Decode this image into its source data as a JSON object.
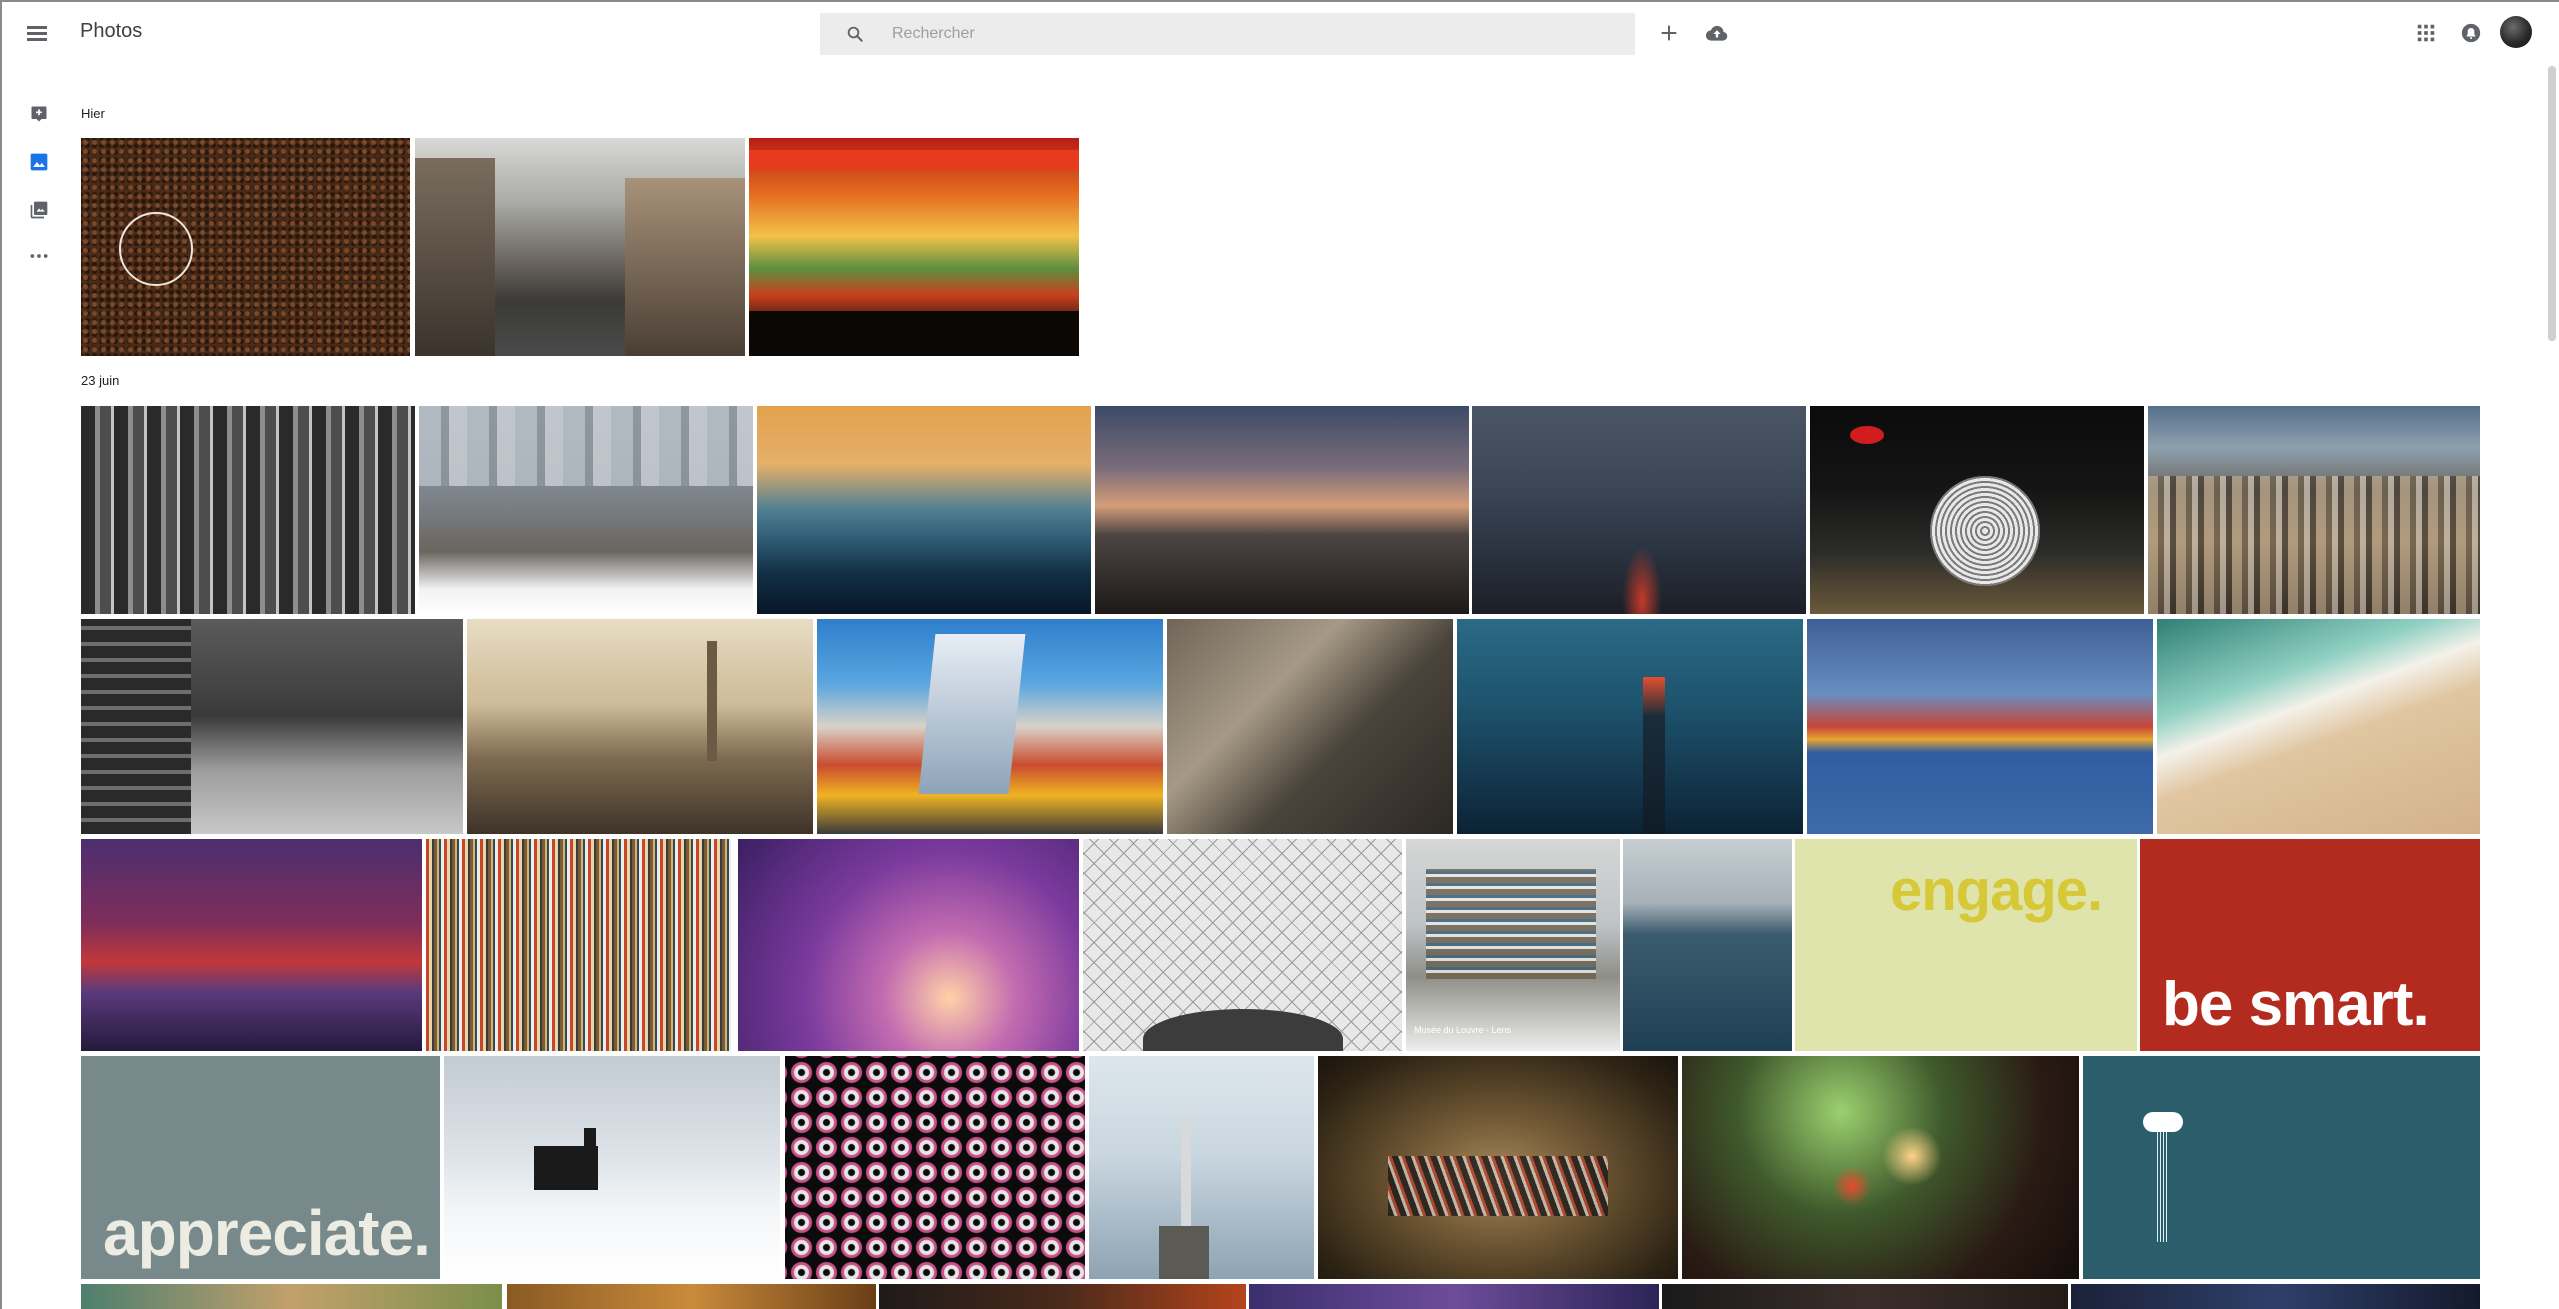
{
  "header": {
    "app_title": "Photos",
    "search_placeholder": "Rechercher"
  },
  "icons": {
    "menu": "menu-icon",
    "search": "search-icon",
    "create": "plus-icon",
    "upload": "cloud-upload-icon",
    "apps": "apps-grid-icon",
    "notifications": "bell-icon",
    "rail": [
      "assistant-icon",
      "photos-icon",
      "albums-icon",
      "more-icon"
    ]
  },
  "colors": {
    "accent": "#1a73e8",
    "icon_gray": "#5f6368",
    "search_bg": "#ececec"
  },
  "sections": [
    {
      "label": "Hier"
    },
    {
      "label": "23 juin"
    }
  ],
  "thumb_texts": {
    "engage": "engage.",
    "be_smart": "be smart.",
    "appreciate": "appreciate.",
    "louvre_caption": "Musée du Louvre - Lens"
  }
}
